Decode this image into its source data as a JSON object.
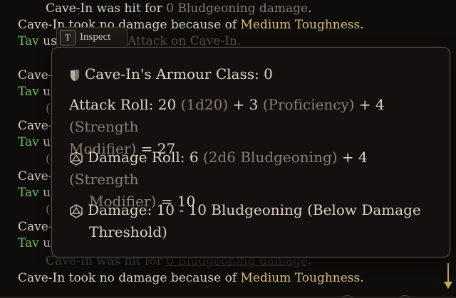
{
  "combat_log": {
    "line1": {
      "a": "Cave-In was hit for ",
      "b": "0 Bludgeoning damage",
      "c": "."
    },
    "line2": {
      "a": "Cave-In took no damage because of ",
      "b": "Medium Toughness",
      "c": "."
    },
    "line3": {
      "a": "Tav",
      "b": " us",
      "c": "nd Attack on Cave-In."
    },
    "frag_cave": "Cave-",
    "frag_tav": "Tav",
    "frag_u": " u",
    "frag_paren": "(",
    "bottom1": {
      "a": "Cave-In was hit for ",
      "b": "0 Bludgeoning damage",
      "c": "."
    },
    "bottom2": {
      "a": "Cave-In took no damage because of ",
      "b": "Medium Toughness",
      "c": "."
    }
  },
  "inspect_tab": {
    "key": "T",
    "label": "Inspect"
  },
  "tooltip": {
    "armour_class": "Cave-In's Armour Class: 0",
    "attack": {
      "label": "Attack Roll: 20 ",
      "dice": "(1d20)",
      "plus1": " + 3 ",
      "prof": "(Proficiency)",
      "plus2": " + 4 ",
      "str": "(Strength",
      "str2": "Modifier)",
      "total": " = 27"
    },
    "damage_roll": {
      "label": "Damage Roll: 6 ",
      "dice": "(2d6 Bludgeoning)",
      "plus": " + 4 ",
      "str": "(Strength",
      "str2": "Modifier)",
      "total": " = 10"
    },
    "damage": {
      "line1": "Damage: 10 - 10 Bludgeoning (Below Damage",
      "line2": "Threshold)"
    }
  },
  "icons": {
    "shield": "shield-icon",
    "dice": "d20-dice-icon",
    "scroll": "scroll-down-arrow-icon"
  },
  "colors": {
    "text": "#d8cfc4",
    "muted": "#857a71",
    "gold": "#d6c07a",
    "green": "#6fbf5a",
    "border": "#5a4d40"
  }
}
